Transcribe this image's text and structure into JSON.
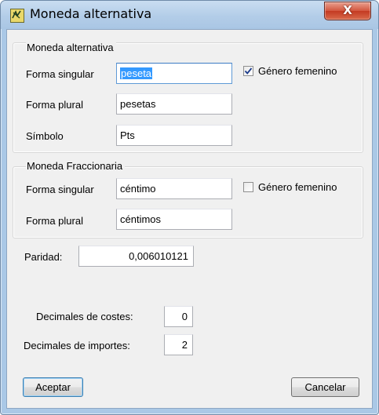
{
  "window": {
    "title": "Moneda alternativa",
    "close_glyph": "X",
    "icon": "app-icon"
  },
  "alternativa": {
    "legend": "Moneda alternativa",
    "singular_label": "Forma singular",
    "singular_value": "peseta",
    "plural_label": "Forma plural",
    "plural_value": "pesetas",
    "symbol_label": "Símbolo",
    "symbol_value": "Pts",
    "feminine_label": "Género femenino",
    "feminine_checked": true
  },
  "fraccionaria": {
    "legend": "Moneda Fraccionaria",
    "singular_label": "Forma singular",
    "singular_value": "céntimo",
    "plural_label": "Forma plural",
    "plural_value": "céntimos",
    "feminine_label": "Género femenino",
    "feminine_checked": false
  },
  "paridad": {
    "label": "Paridad:",
    "value": "0,006010121"
  },
  "decimales_costes": {
    "label": "Decimales de costes:",
    "value": "0"
  },
  "decimales_importes": {
    "label": "Decimales de importes:",
    "value": "2"
  },
  "buttons": {
    "accept": "Aceptar",
    "cancel": "Cancelar"
  },
  "colors": {
    "title_bar": "#b3cde8",
    "close_button": "#c33a22",
    "selection": "#3399ff",
    "dialog_bg": "#f0f0f0"
  }
}
